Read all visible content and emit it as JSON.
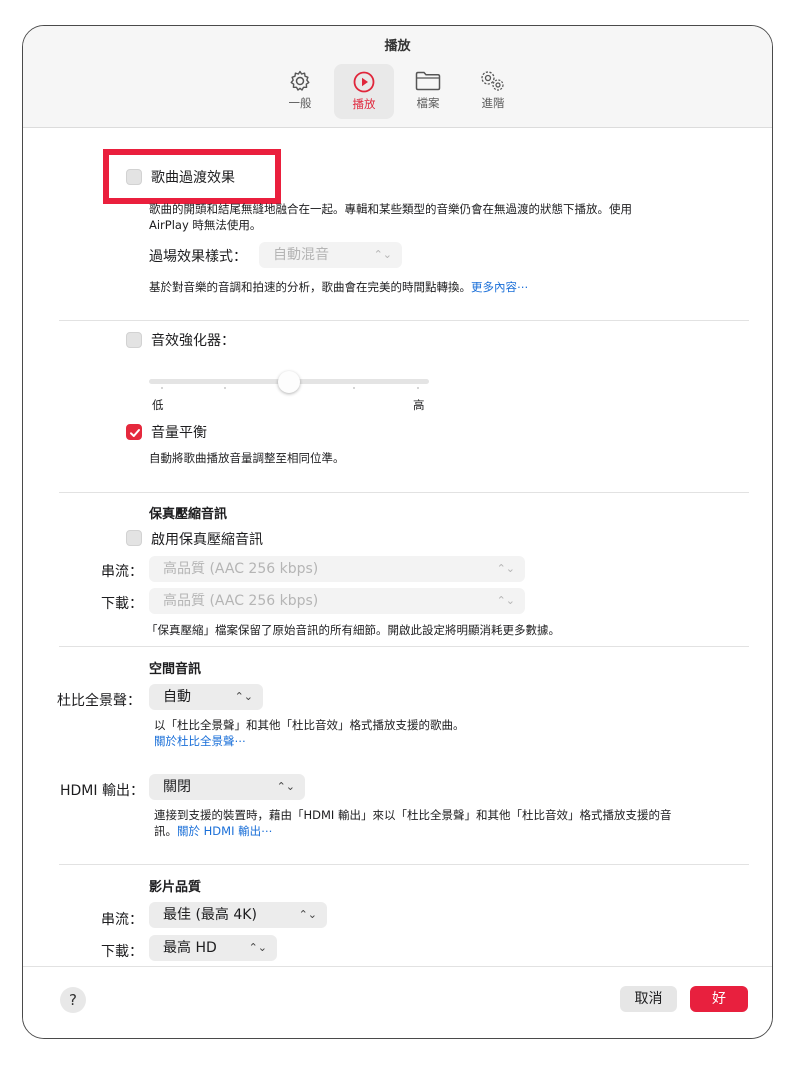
{
  "window": {
    "title": "播放"
  },
  "toolbar": {
    "tabs": [
      {
        "label": "一般",
        "icon": "gear-icon"
      },
      {
        "label": "播放",
        "icon": "play-circle-icon",
        "active": true
      },
      {
        "label": "檔案",
        "icon": "folder-icon"
      },
      {
        "label": "進階",
        "icon": "gears-icon"
      }
    ]
  },
  "crossfade": {
    "label": "歌曲過渡效果",
    "checked": false,
    "desc_line1": "歌曲的開頭和結尾無縫地融合在一起。專輯和某些類型的音樂仍會在無過渡的狀態下播放。使用",
    "desc_line2": "AirPlay 時無法使用。",
    "style_label": "過場效果樣式：",
    "style_value": "自動混音",
    "analysis_desc": "基於對音樂的音調和拍速的分析，歌曲會在完美的時間點轉換。",
    "more_link": "更多內容⋯"
  },
  "sound_enhancer": {
    "label": "音效強化器：",
    "checked": false,
    "level": 0.5,
    "low_label": "低",
    "high_label": "高"
  },
  "sound_check": {
    "label": "音量平衡",
    "checked": true,
    "desc": "自動將歌曲播放音量調整至相同位準。"
  },
  "lossless": {
    "heading": "保真壓縮音訊",
    "enable_label": "啟用保真壓縮音訊",
    "checked": false,
    "streaming_label": "串流：",
    "streaming_value": "高品質 (AAC 256 kbps)",
    "download_label": "下載：",
    "download_value": "高品質 (AAC 256 kbps)",
    "desc": "「保真壓縮」檔案保留了原始音訊的所有細節。開啟此設定將明顯消耗更多數據。"
  },
  "spatial": {
    "heading": "空間音訊",
    "atmos_label": "杜比全景聲：",
    "atmos_value": "自動",
    "atmos_desc": "以「杜比全景聲」和其他「杜比音效」格式播放支援的歌曲。",
    "atmos_link": "關於杜比全景聲⋯",
    "hdmi_label": "HDMI 輸出：",
    "hdmi_value": "關閉",
    "hdmi_desc_line1": "連接到支援的裝置時，藉由「HDMI 輸出」來以「杜比全景聲」和其他「杜比音效」格式播放支援的音",
    "hdmi_desc_line2": "訊。",
    "hdmi_link": "關於 HDMI 輸出⋯"
  },
  "video": {
    "heading": "影片品質",
    "streaming_label": "串流：",
    "streaming_value": "最佳 (最高 4K)",
    "download_label": "下載：",
    "download_value": "最高 HD"
  },
  "footer": {
    "help": "?",
    "cancel": "取消",
    "ok": "好"
  },
  "colors": {
    "accent": "#e8203e",
    "link": "#1a6fd8"
  }
}
